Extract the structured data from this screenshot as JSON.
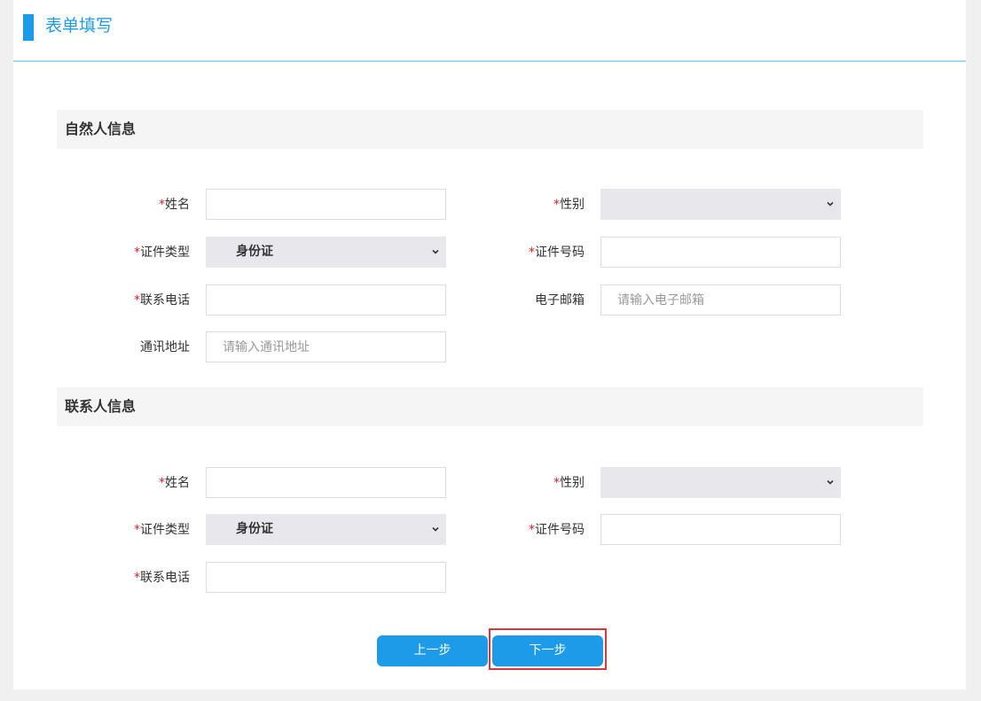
{
  "header": {
    "title": "表单填写",
    "top_fragment": "…"
  },
  "natural_person": {
    "section_title": "自然人信息",
    "name_label": "姓名",
    "gender_label": "性别",
    "id_type_label": "证件类型",
    "id_type_value": "身份证",
    "id_number_label": "证件号码",
    "phone_label": "联系电话",
    "email_label": "电子邮箱",
    "email_placeholder": "请输入电子邮箱",
    "address_label": "通讯地址",
    "address_placeholder": "请输入通讯地址",
    "required_mark": "*"
  },
  "contact_person": {
    "section_title": "联系人信息",
    "name_label": "姓名",
    "gender_label": "性别",
    "id_type_label": "证件类型",
    "id_type_value": "身份证",
    "id_number_label": "证件号码",
    "phone_label": "联系电话",
    "required_mark": "*"
  },
  "buttons": {
    "prev_label": "上一步",
    "next_label": "下一步"
  },
  "colors": {
    "accent": "#1e9be8",
    "required": "#e02020",
    "highlight_border": "#d9363e"
  }
}
